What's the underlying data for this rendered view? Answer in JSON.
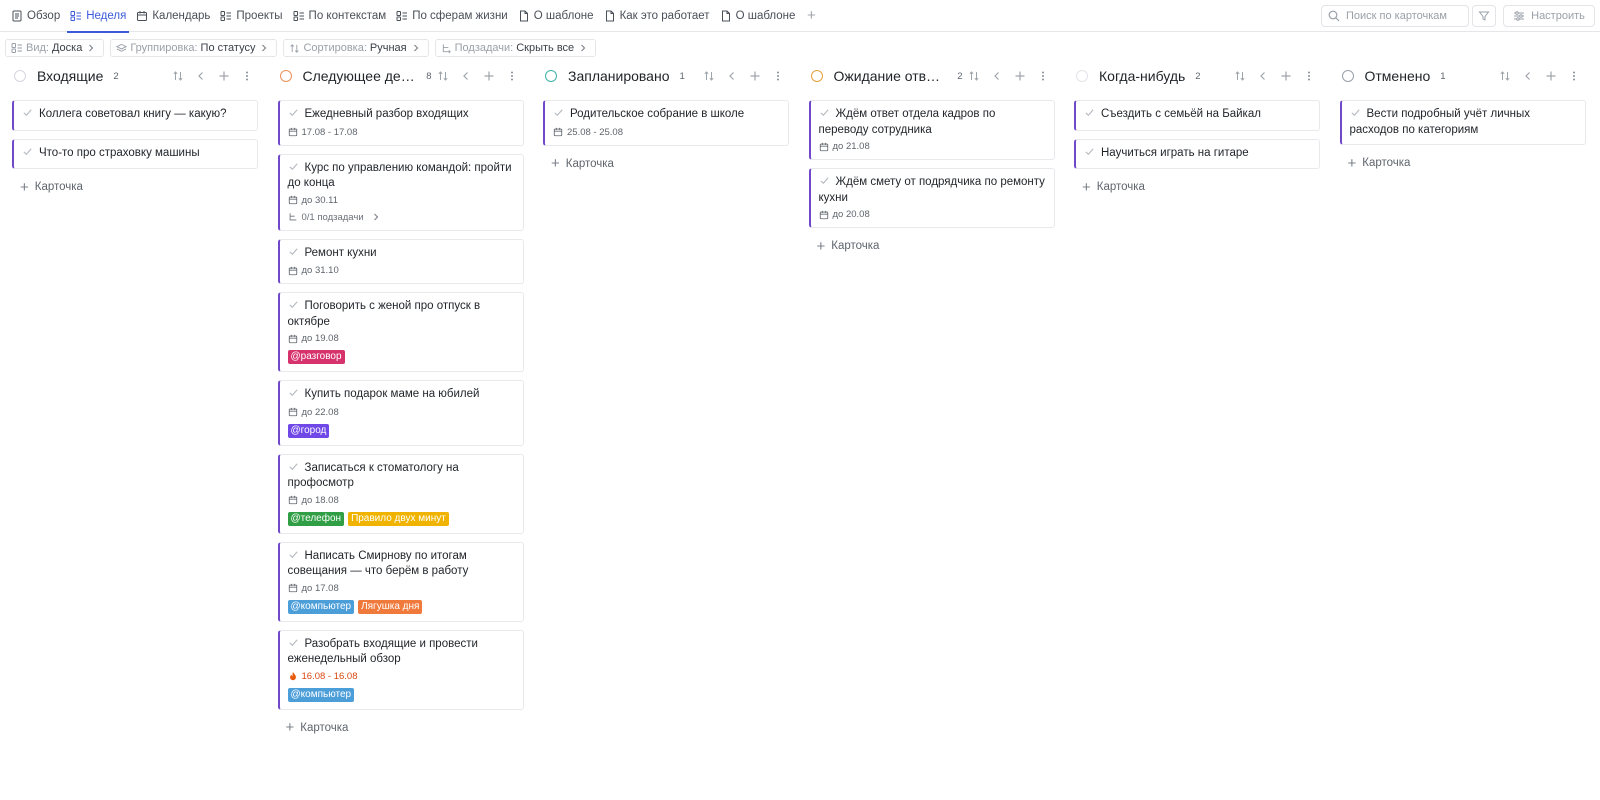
{
  "tabs": [
    {
      "label": "Обзор",
      "icon": "document-list-icon"
    },
    {
      "label": "Неделя",
      "icon": "board-icon",
      "active": true
    },
    {
      "label": "Календарь",
      "icon": "calendar-icon"
    },
    {
      "label": "Проекты",
      "icon": "board-icon"
    },
    {
      "label": "По контекстам",
      "icon": "board-icon"
    },
    {
      "label": "По сферам жизни",
      "icon": "board-icon"
    },
    {
      "label": "О шаблоне",
      "icon": "page-icon"
    },
    {
      "label": "Как это работает",
      "icon": "page-icon"
    },
    {
      "label": "О шаблоне",
      "icon": "page-icon"
    }
  ],
  "search": {
    "placeholder": "Поиск по карточкам"
  },
  "setup_label": "Настроить",
  "chips": [
    {
      "key": "Вид:",
      "value": "Доска",
      "icon": "board-icon"
    },
    {
      "key": "Группировка:",
      "value": "По статусу",
      "icon": "layers-icon"
    },
    {
      "key": "Сортировка:",
      "value": "Ручная",
      "icon": "sort-icon"
    },
    {
      "key": "Подзадачи:",
      "value": "Скрыть все",
      "icon": "subtask-icon"
    }
  ],
  "add_card_label": "Карточка",
  "colors": {
    "accent": "#3b5bdb",
    "card_border": "#7048c9"
  },
  "columns": [
    {
      "title": "Входящие",
      "count": "2",
      "circle_color": "#d4d7dc",
      "cards": [
        {
          "title": "Коллега советовал книгу — какую?"
        },
        {
          "title": "Что-то про страховку машины"
        }
      ]
    },
    {
      "title": "Следующее действие",
      "count": "8",
      "circle_color": "#e8915a",
      "cards": [
        {
          "title": "Ежедневный разбор входящих",
          "date": "17.08 - 17.08"
        },
        {
          "title": "Курс по управлению командой: пройти до конца",
          "date": "до 30.11",
          "subtasks": "0/1 подзадачи"
        },
        {
          "title": "Ремонт кухни",
          "date": "до 31.10"
        },
        {
          "title": "Поговорить с женой про отпуск в октябре",
          "date": "до 19.08",
          "tags": [
            {
              "text": "@разговор",
              "color": "#d6336c"
            }
          ]
        },
        {
          "title": "Купить подарок маме на юбилей",
          "date": "до 22.08",
          "tags": [
            {
              "text": "@город",
              "color": "#7048e8"
            }
          ]
        },
        {
          "title": "Записаться к стоматологу на профосмотр",
          "date": "до 18.08",
          "tags": [
            {
              "text": "@телефон",
              "color": "#2f9e44"
            },
            {
              "text": "Правило двух минут",
              "color": "#f0b400"
            }
          ]
        },
        {
          "title": "Написать Смирнову по итогам совещания — что берём в работу",
          "date": "до 17.08",
          "tags": [
            {
              "text": "@компьютер",
              "color": "#4c9ed9"
            },
            {
              "text": "Лягушка дня",
              "color": "#f07a3c"
            }
          ]
        },
        {
          "title": "Разобрать входящие и провести еженедельный обзор",
          "date": "16.08 - 16.08",
          "hot": true,
          "tags": [
            {
              "text": "@компьютер",
              "color": "#4c9ed9"
            }
          ]
        }
      ]
    },
    {
      "title": "Запланировано",
      "count": "1",
      "circle_color": "#3fb3a8",
      "cards": [
        {
          "title": "Родительское собрание в школе",
          "date": "25.08 - 25.08"
        }
      ]
    },
    {
      "title": "Ожидание ответа",
      "count": "2",
      "circle_color": "#e8a23c",
      "cards": [
        {
          "title": "Ждём ответ отдела кадров по переводу сотрудника",
          "date": "до 21.08"
        },
        {
          "title": "Ждём смету от подрядчика по ремонту кухни",
          "date": "до 20.08"
        }
      ]
    },
    {
      "title": "Когда-нибудь",
      "count": "2",
      "circle_color": "#e2e4e8",
      "cards": [
        {
          "title": "Съездить с семьёй на Байкал"
        },
        {
          "title": "Научиться играть на гитаре"
        }
      ]
    },
    {
      "title": "Отменено",
      "count": "1",
      "circle_color": "#9aa0a8",
      "cards": [
        {
          "title": "Вести подробный учёт личных расходов по категориям"
        }
      ]
    }
  ]
}
